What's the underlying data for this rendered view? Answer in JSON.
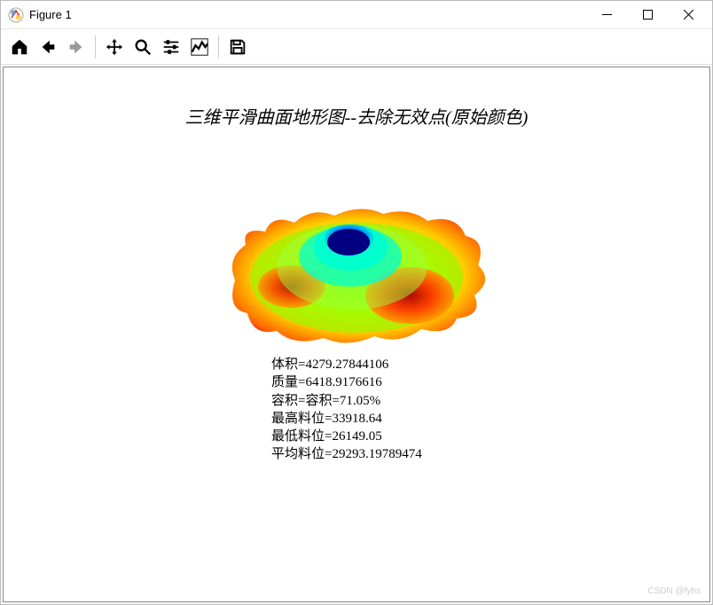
{
  "window": {
    "title": "Figure 1"
  },
  "toolbar": {
    "home": "Home",
    "back": "Back",
    "forward": "Forward",
    "pan": "Pan",
    "zoom": "Zoom",
    "configure": "Configure subplots",
    "edit": "Edit axis",
    "save": "Save"
  },
  "chart_data": {
    "type": "surface",
    "title": "三维平滑曲面地形图--去除无效点(原始颜色)",
    "annotations": {
      "volume_label": "体积=",
      "volume_value": "4279.27844106",
      "mass_label": "质量=",
      "mass_value": "6418.9176616",
      "capacity_label": "容积=容积=",
      "capacity_value": "71.05%",
      "max_label": "最高料位=",
      "max_value": "33918.64",
      "min_label": "最低料位=",
      "min_value": "26149.05",
      "avg_label": "平均料位=",
      "avg_value": "29293.19789474"
    },
    "z_range": [
      26149.05,
      33918.64
    ],
    "colormap": "jet",
    "description": "3D smoothed terrain surface, invalid points removed, original colors"
  },
  "watermark": "CSDN @fyhs"
}
